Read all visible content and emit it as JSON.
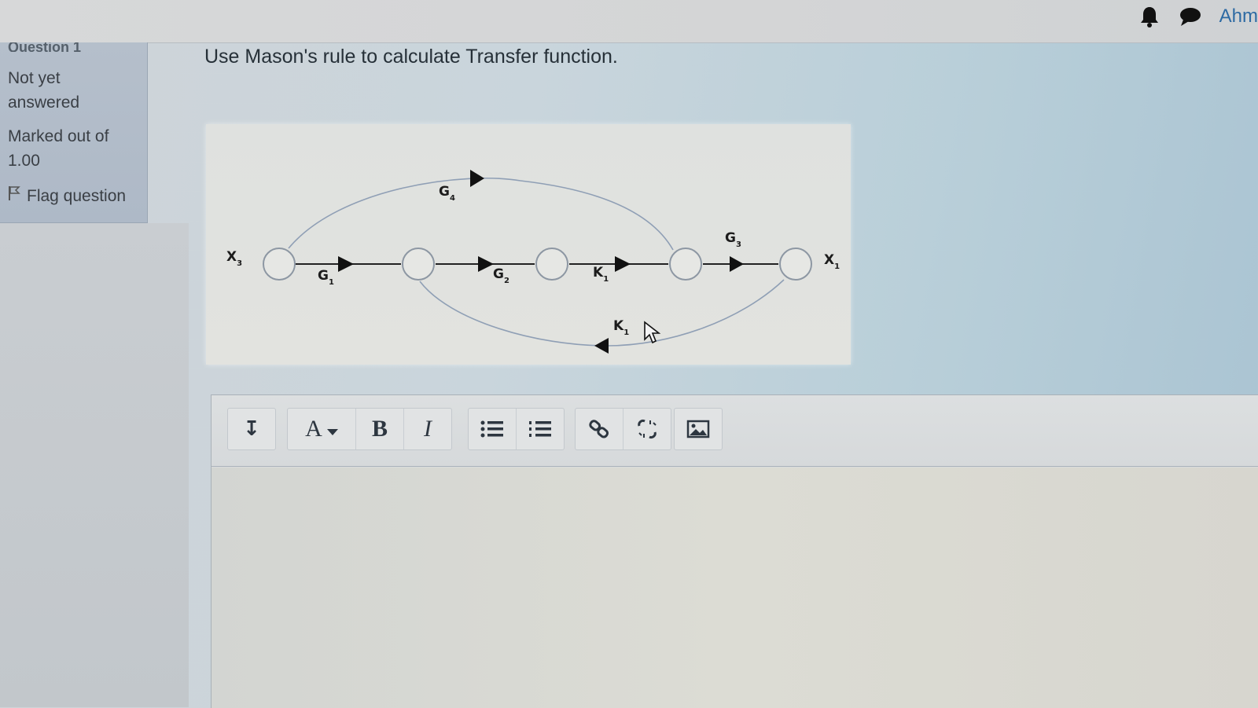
{
  "header": {
    "user_name": "Ahm",
    "icons": [
      "bell-icon",
      "chat-icon"
    ]
  },
  "question_info": {
    "title": "Question 1",
    "state": "Not yet answered",
    "grade": "Marked out of 1.00",
    "flag_label": "Flag question"
  },
  "question": {
    "text": "Use Mason's rule to calculate Transfer function."
  },
  "diagram": {
    "input_label": "X",
    "input_sub": "3",
    "output_label": "X",
    "output_sub": "1",
    "branches": {
      "g1": {
        "label": "G",
        "sub": "1"
      },
      "g2": {
        "label": "G",
        "sub": "2"
      },
      "k1_forward": {
        "label": "K",
        "sub": "1"
      },
      "g3": {
        "label": "G",
        "sub": "3"
      },
      "g4": {
        "label": "G",
        "sub": "4"
      },
      "k1_feedback": {
        "label": "K",
        "sub": "1"
      }
    }
  },
  "editor": {
    "toolbar": {
      "collapse": "↧",
      "font": "A",
      "bold": "B",
      "italic": "I"
    },
    "content": ""
  },
  "colors": {
    "link_blue": "#2d6aa3",
    "panel_bg": "#b5bfcb"
  }
}
